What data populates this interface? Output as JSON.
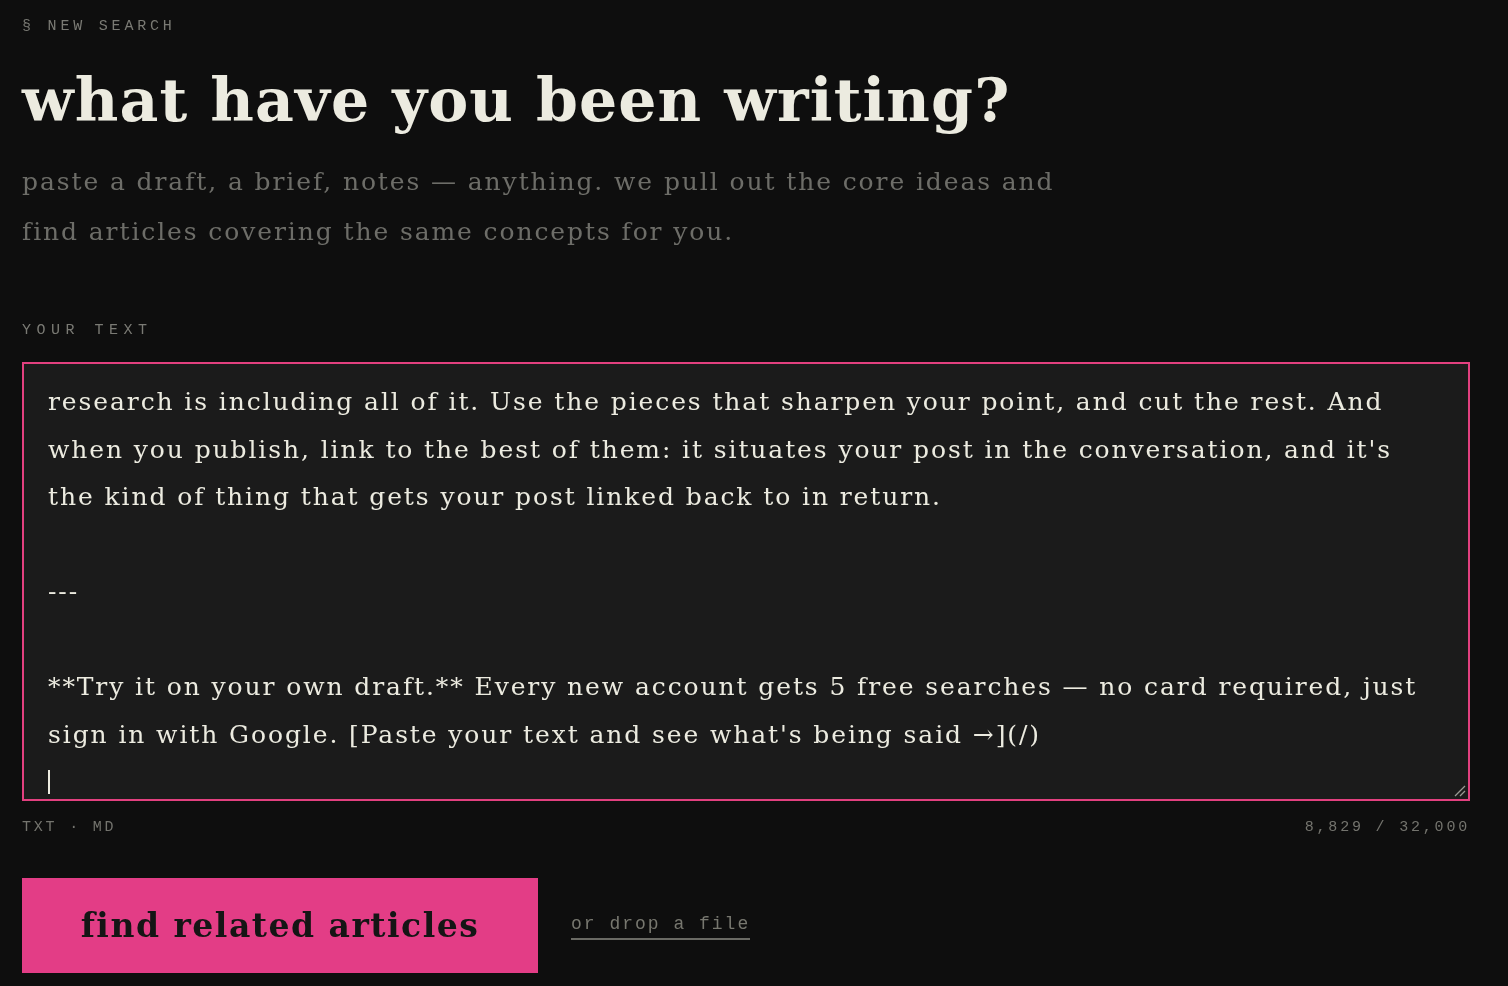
{
  "section_label": "§ NEW SEARCH",
  "title": "what have you been writing?",
  "subtitle": "paste a draft, a brief, notes — anything. we pull out the core ideas and find articles covering the same concepts for you.",
  "text_field": {
    "label": "YOUR TEXT",
    "value": "research is including all of it. Use the pieces that sharpen your point, and cut the rest. And when you publish, link to the best of them: it situates your post in the conversation, and it's the kind of thing that gets your post linked back to in return.\n\n---\n\n**Try it on your own draft.** Every new account gets 5 free searches — no card required, just sign in with Google. [Paste your text and see what's being said →](/)\n",
    "focused": true
  },
  "formats": "TXT · MD",
  "char_count": "8,829 / 32,000",
  "submit_button": "find related articles",
  "drop_link": "or drop a file"
}
